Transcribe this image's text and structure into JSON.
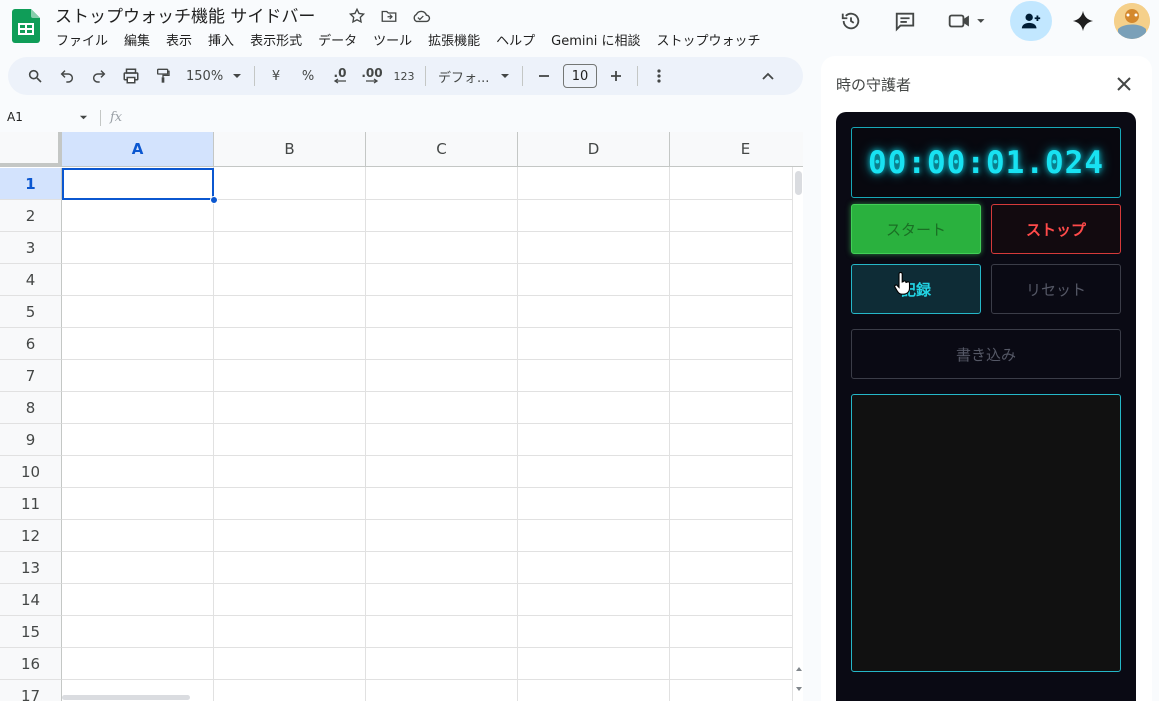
{
  "header": {
    "doc_title": "ストップウォッチ機能 サイドバー",
    "menu": [
      "ファイル",
      "編集",
      "表示",
      "挿入",
      "表示形式",
      "データ",
      "ツール",
      "拡張機能",
      "ヘルプ",
      "Gemini に相談",
      "ストップウォッチ"
    ]
  },
  "toolbar": {
    "zoom": "150%",
    "currency": "¥",
    "percent": "%",
    "decrease_decimal": ".0",
    "increase_decimal": ".00",
    "number_format": "123",
    "font": "デフォ...",
    "font_size": "10"
  },
  "formula_bar": {
    "cell_ref": "A1",
    "fx": "fx"
  },
  "grid": {
    "columns": [
      "A",
      "B",
      "C",
      "D",
      "E"
    ],
    "rows": [
      "1",
      "2",
      "3",
      "4",
      "5",
      "6",
      "7",
      "8",
      "9",
      "10",
      "11",
      "12",
      "13",
      "14",
      "15",
      "16",
      "17"
    ],
    "selected_cell": "A1"
  },
  "sidebar": {
    "title": "時の守護者",
    "timer": "00:00:01.024",
    "start_label": "スタート",
    "stop_label": "ストップ",
    "record_label": "記録",
    "reset_label": "リセット",
    "write_label": "書き込み"
  },
  "colors": {
    "sheet_accent": "#0b57d0",
    "timer_cyan": "#18e2f2",
    "start_green": "#2ab13e",
    "stop_red": "#ff4a4a",
    "panel_bg": "#0a0a14"
  }
}
